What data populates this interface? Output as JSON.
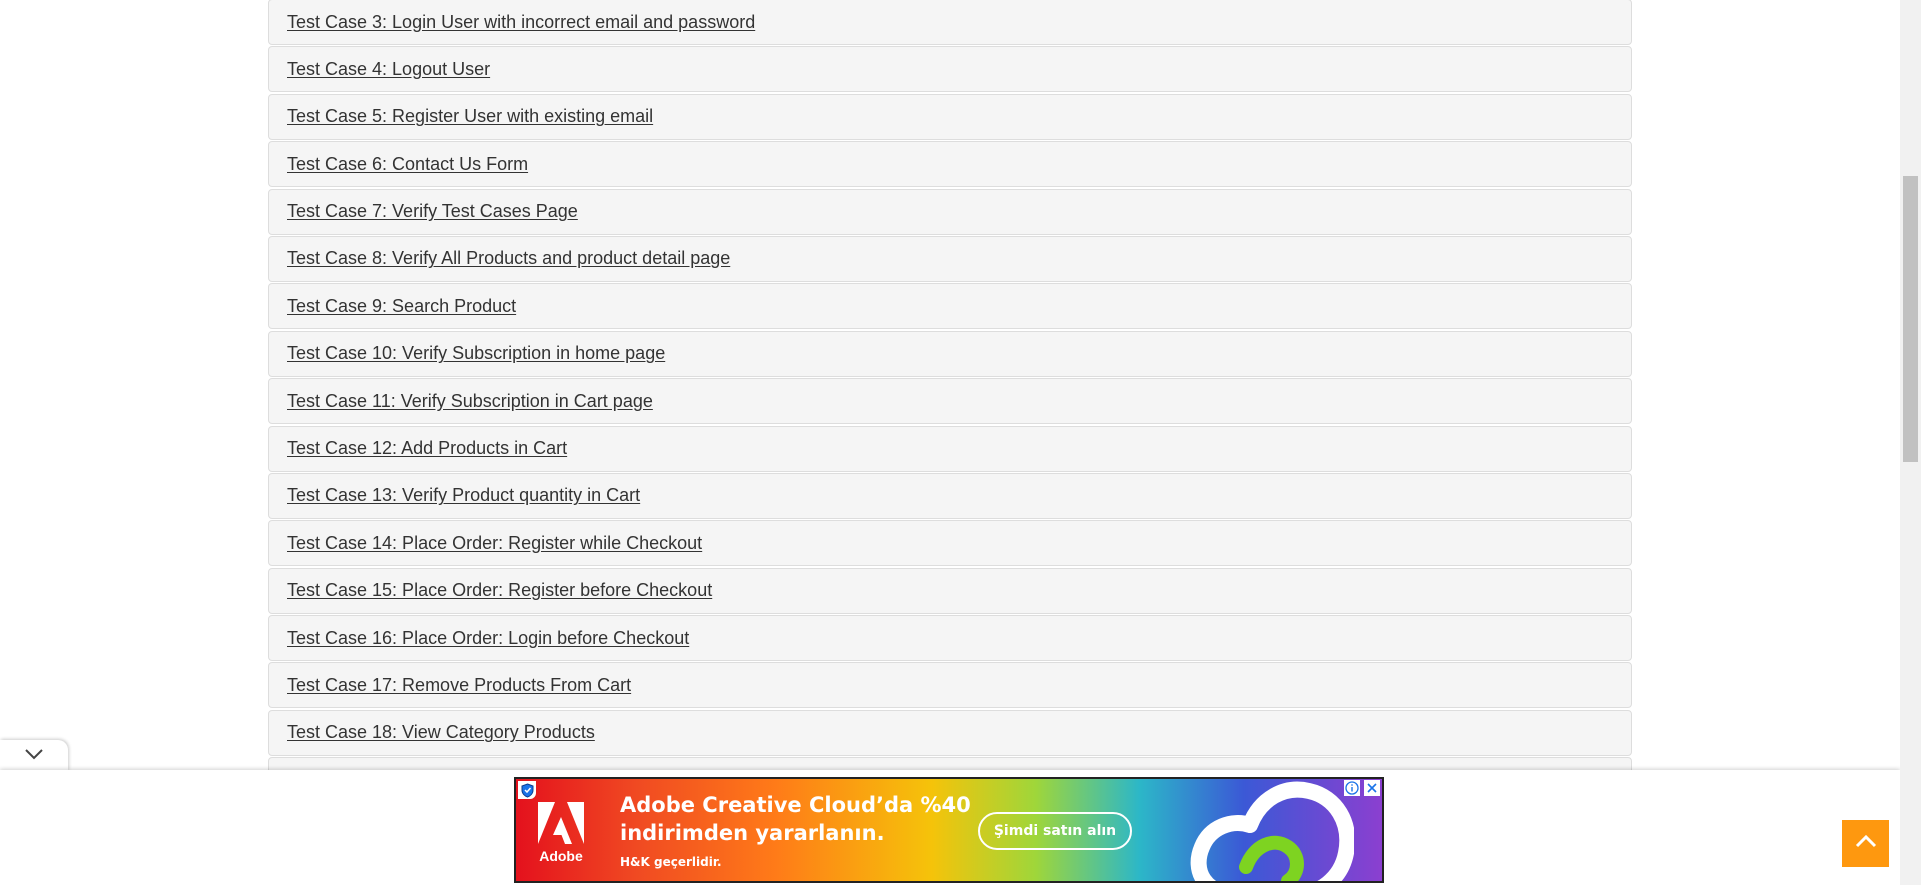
{
  "test_cases": [
    {
      "label": "Test Case 3: Login User with incorrect email and password"
    },
    {
      "label": "Test Case 4: Logout User"
    },
    {
      "label": "Test Case 5: Register User with existing email"
    },
    {
      "label": "Test Case 6: Contact Us Form"
    },
    {
      "label": "Test Case 7: Verify Test Cases Page"
    },
    {
      "label": "Test Case 8: Verify All Products and product detail page"
    },
    {
      "label": "Test Case 9: Search Product"
    },
    {
      "label": "Test Case 10: Verify Subscription in home page"
    },
    {
      "label": "Test Case 11: Verify Subscription in Cart page"
    },
    {
      "label": "Test Case 12: Add Products in Cart"
    },
    {
      "label": "Test Case 13: Verify Product quantity in Cart"
    },
    {
      "label": "Test Case 14: Place Order: Register while Checkout"
    },
    {
      "label": "Test Case 15: Place Order: Register before Checkout"
    },
    {
      "label": "Test Case 16: Place Order: Login before Checkout"
    },
    {
      "label": "Test Case 17: Remove Products From Cart"
    },
    {
      "label": "Test Case 18: View Category Products"
    },
    {
      "label": ""
    }
  ],
  "ad": {
    "brand_label": "Adobe",
    "headline": "Adobe Creative Cloud’da %40 indirimden yararlanın.",
    "subtext": "H&K geçerlidir.",
    "cta_label": "Şimdi satın alın"
  },
  "colors": {
    "accent": "#fe980f",
    "row_background": "#f5f5f5",
    "link_text": "#333333"
  },
  "icons": {
    "collapse": "chevron-down-icon",
    "scroll_top": "chevron-up-icon",
    "ad_close": "close-icon",
    "ad_choices": "info-icon",
    "ad_shield": "shield-icon"
  }
}
